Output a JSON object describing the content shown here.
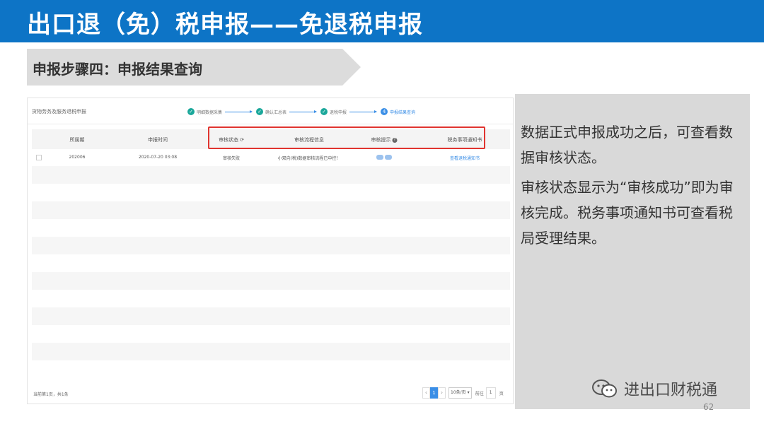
{
  "title": "出口退（免）税申报——免退税申报",
  "step": "申报步骤四：申报结果查询",
  "panel": {
    "breadcrumb": "货物劳务及服务退税申报",
    "steps": [
      {
        "label": "明细数据采集",
        "icon": "check-icon"
      },
      {
        "label": "确认汇总表",
        "icon": "check-icon"
      },
      {
        "label": "退税申报",
        "icon": "check-icon"
      },
      {
        "label": "申报结果查询",
        "icon": "step-number-icon",
        "number": "4"
      }
    ],
    "columns": [
      "所属期",
      "申报时间",
      "审核状态",
      "审核流程信息",
      "审核提示",
      "税务事项通知书"
    ],
    "row": {
      "period": "202006",
      "time": "2020-07-20 03:08",
      "status": "审核失败",
      "flow": "小双向(税)数据审核流程已中控！",
      "notice": "查看退税通知书"
    },
    "footer": "当前第1页，共1条",
    "pager": {
      "prev": "‹",
      "page": "1",
      "next": "›",
      "page_size": "10条/页",
      "goto_label": "前往",
      "goto_value": "1",
      "page_unit": "页"
    }
  },
  "note": {
    "p1": "数据正式申报成功之后，可查看数据审核状态。",
    "p2": "审核状态显示为“审核成功”即为审核完成。税务事项通知书可查看税局受理结果。"
  },
  "brand": "进出口财税通",
  "page_number": "62",
  "colors": {
    "title_bar": "#0d74c6",
    "highlight": "#e0342f",
    "accent": "#3a8ee6",
    "note_bg": "#d9d9d9"
  }
}
